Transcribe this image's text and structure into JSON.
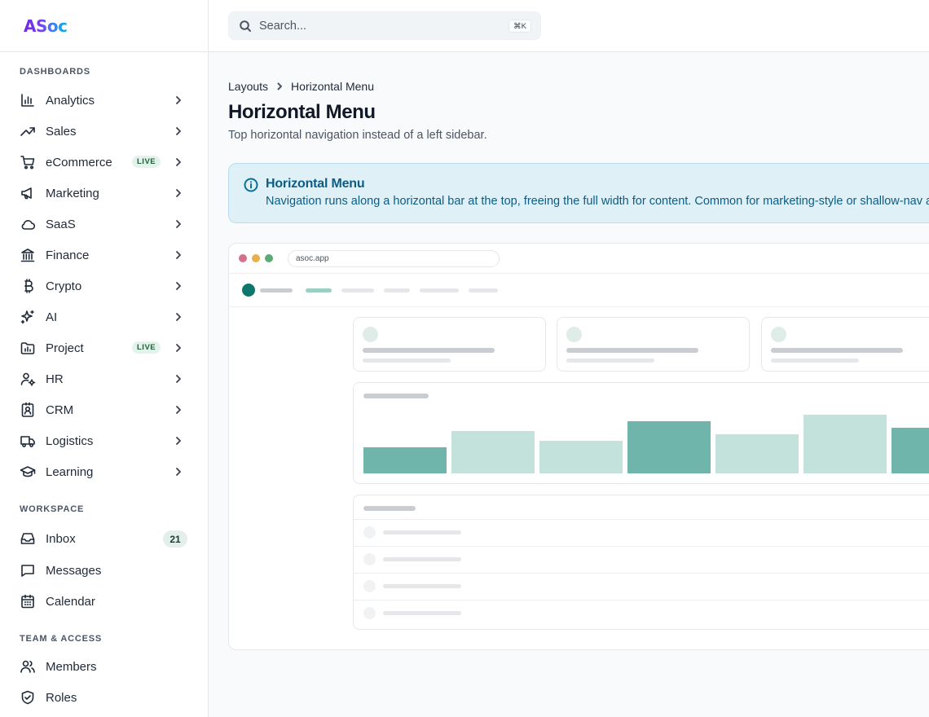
{
  "brand": {
    "name": "ASoc"
  },
  "search": {
    "placeholder": "Search...",
    "shortcut": "⌘K"
  },
  "sidebar": {
    "sections": [
      {
        "label": "DASHBOARDS"
      },
      {
        "label": "WORKSPACE"
      },
      {
        "label": "TEAM & ACCESS"
      }
    ],
    "dashboards": [
      {
        "label": "Analytics",
        "icon": "bar-chart-icon"
      },
      {
        "label": "Sales",
        "icon": "trending-up-icon"
      },
      {
        "label": "eCommerce",
        "icon": "cart-icon",
        "badge": "LIVE"
      },
      {
        "label": "Marketing",
        "icon": "megaphone-icon"
      },
      {
        "label": "SaaS",
        "icon": "cloud-icon"
      },
      {
        "label": "Finance",
        "icon": "bank-icon"
      },
      {
        "label": "Crypto",
        "icon": "bitcoin-icon"
      },
      {
        "label": "AI",
        "icon": "sparkles-icon"
      },
      {
        "label": "Project",
        "icon": "folder-chart-icon",
        "badge": "LIVE"
      },
      {
        "label": "HR",
        "icon": "user-cog-icon"
      },
      {
        "label": "CRM",
        "icon": "contact-card-icon"
      },
      {
        "label": "Logistics",
        "icon": "truck-icon"
      },
      {
        "label": "Learning",
        "icon": "graduation-cap-icon"
      }
    ],
    "workspace": [
      {
        "label": "Inbox",
        "icon": "inbox-icon",
        "count": "21"
      },
      {
        "label": "Messages",
        "icon": "message-icon"
      },
      {
        "label": "Calendar",
        "icon": "calendar-icon"
      }
    ],
    "team": [
      {
        "label": "Members",
        "icon": "users-icon"
      },
      {
        "label": "Roles",
        "icon": "shield-check-icon"
      }
    ]
  },
  "breadcrumb": {
    "parent": "Layouts",
    "current": "Horizontal Menu"
  },
  "page": {
    "title": "Horizontal Menu",
    "subtitle": "Top horizontal navigation instead of a left sidebar."
  },
  "alert": {
    "title": "Horizontal Menu",
    "text": "Navigation runs along a horizontal bar at the top, freeing the full width for content. Common for marketing-style or shallow-nav apps."
  },
  "preview": {
    "url": "asoc.app",
    "colors": {
      "dot_red": "#d4728a",
      "dot_yellow": "#e8b04c",
      "dot_green": "#5aab74",
      "accent": "#0f766e",
      "bar_strong": "#6fb5ab",
      "bar_soft": "#c4e2dc"
    },
    "chart_bars": [
      {
        "level": 0.44,
        "tone": "strong"
      },
      {
        "level": 0.72,
        "tone": "soft"
      },
      {
        "level": 0.56,
        "tone": "soft"
      },
      {
        "level": 0.89,
        "tone": "strong"
      },
      {
        "level": 0.67,
        "tone": "soft"
      },
      {
        "level": 1.0,
        "tone": "soft"
      },
      {
        "level": 0.78,
        "tone": "strong"
      }
    ]
  }
}
